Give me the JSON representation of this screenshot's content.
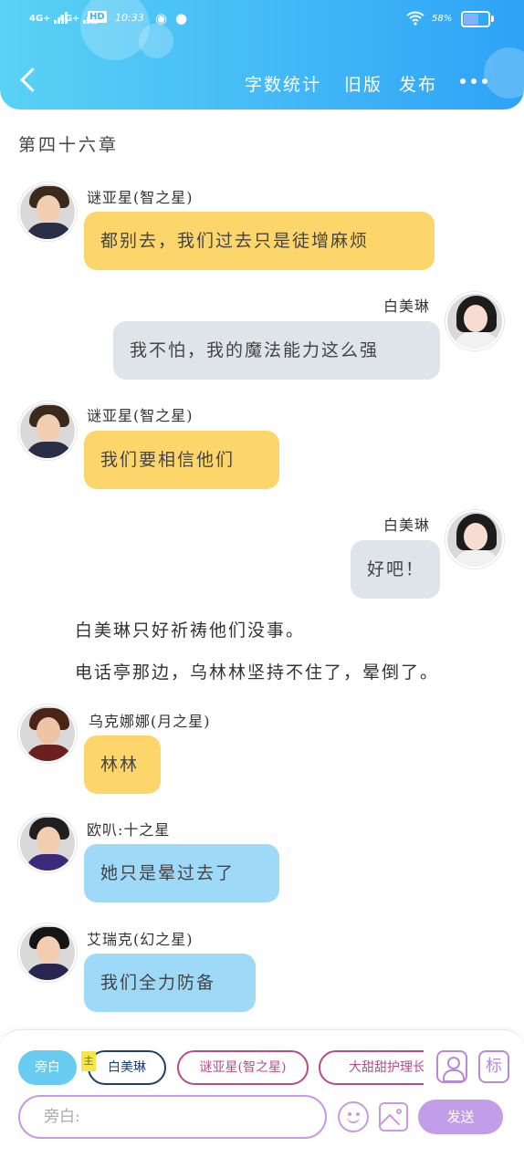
{
  "status_bar": {
    "network1": "4G+",
    "network2": "4G+",
    "hd": "HD",
    "time": "10:33",
    "battery": "58%",
    "battery_level": 0.58
  },
  "header": {
    "word_count": "字数统计",
    "old_version": "旧版",
    "publish": "发布"
  },
  "chapter_title": "第四十六章",
  "messages": [
    {
      "speaker": "谜亚星(智之星)",
      "text": "都别去，我们过去只是徒增麻烦"
    },
    {
      "speaker": "白美琳",
      "text": "我不怕，我的魔法能力这么强"
    },
    {
      "speaker": "谜亚星(智之星)",
      "text": "我们要相信他们"
    },
    {
      "speaker": "白美琳",
      "text": "好吧！"
    }
  ],
  "narration": [
    "白美琳只好祈祷他们没事。",
    "电话亭那边，乌林林坚持不住了，晕倒了。"
  ],
  "messages2": [
    {
      "speaker": "乌克娜娜(月之星)",
      "text": "林林"
    },
    {
      "speaker": "欧叭:十之星",
      "text": "她只是晕过去了"
    },
    {
      "speaker": "艾瑞克(幻之星)",
      "text": "我们全力防备"
    }
  ],
  "bottom": {
    "chips": [
      "旁白",
      "白美琳",
      "谜亚星(智之星)",
      "大甜甜护理长"
    ],
    "main_badge": "主",
    "tag_button": "标",
    "input_placeholder": "旁白:",
    "send": "发送"
  },
  "colors": {
    "header_accent": "#43b8f7",
    "left_bubble": "#fdd66b",
    "right_bubble": "#dfe3ea",
    "other_bubble": "#9ed9f7",
    "purple_accent": "#c29ee8"
  }
}
